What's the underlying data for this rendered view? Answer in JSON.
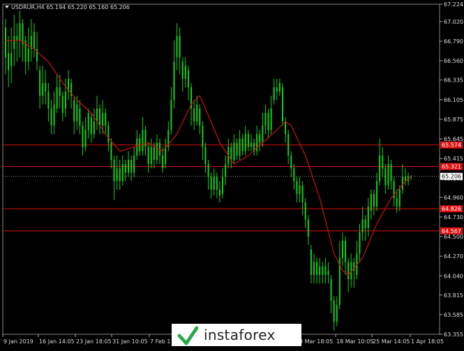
{
  "chart_data": {
    "type": "candlestick",
    "symbol_line": {
      "symbol": "USDRUR,H4",
      "open": "65.194",
      "high": "65.220",
      "low": "65.160",
      "close": "65.206"
    },
    "ylim": [
      63.355,
      67.224
    ],
    "y_ticks": [
      "67.224",
      "67.020",
      "66.790",
      "66.560",
      "66.335",
      "66.105",
      "65.875",
      "65.645",
      "65.415",
      "65.185",
      "64.960",
      "64.730",
      "64.500",
      "64.270",
      "64.040",
      "63.815",
      "63.585",
      "63.355"
    ],
    "x_labels": [
      "9 Jan 2019",
      "16 Jan 14:05",
      "23 Jan 18:05",
      "31 Jan 10:05",
      "7 Feb 1",
      "8 Mar 18:05",
      "18 Mar 10:05",
      "25 Mar 14:05",
      "1 Apr 18:05"
    ],
    "current_price": "65.206",
    "levels": [
      {
        "label": "65.574",
        "value": 65.574
      },
      {
        "label": "65.321",
        "value": 65.321
      },
      {
        "label": "64.826",
        "value": 64.826
      },
      {
        "label": "64.567",
        "value": 64.567
      }
    ],
    "x_count": 152,
    "candles": [
      [
        0,
        66.95,
        66.6,
        67.05,
        66.4
      ],
      [
        1,
        66.65,
        66.45,
        66.85,
        66.25
      ],
      [
        2,
        66.5,
        66.65,
        66.95,
        66.3
      ],
      [
        3,
        66.7,
        66.85,
        67.1,
        66.5
      ],
      [
        4,
        66.85,
        66.8,
        67.0,
        66.55
      ],
      [
        5,
        66.8,
        67.0,
        67.15,
        66.6
      ],
      [
        6,
        67.0,
        66.75,
        67.05,
        66.55
      ],
      [
        7,
        66.8,
        66.55,
        66.85,
        66.4
      ],
      [
        8,
        66.55,
        66.7,
        66.95,
        66.45
      ],
      [
        9,
        66.7,
        66.85,
        67.05,
        66.55
      ],
      [
        10,
        66.9,
        66.7,
        67.0,
        66.6
      ],
      [
        11,
        66.7,
        66.55,
        66.9,
        66.45
      ],
      [
        12,
        66.45,
        66.15,
        66.5,
        66.0
      ],
      [
        13,
        66.15,
        66.3,
        66.5,
        66.05
      ],
      [
        14,
        66.3,
        66.2,
        66.45,
        66.05
      ],
      [
        15,
        66.2,
        66.0,
        66.3,
        65.85
      ],
      [
        16,
        66.0,
        65.8,
        66.1,
        65.7
      ],
      [
        17,
        65.8,
        66.05,
        66.2,
        65.7
      ],
      [
        18,
        66.0,
        66.25,
        66.4,
        65.95
      ],
      [
        19,
        66.25,
        66.15,
        66.4,
        66.0
      ],
      [
        20,
        66.15,
        65.95,
        66.2,
        65.85
      ],
      [
        21,
        66.0,
        66.2,
        66.35,
        65.9
      ],
      [
        22,
        66.2,
        66.35,
        66.45,
        66.1
      ],
      [
        23,
        66.3,
        66.15,
        66.35,
        66.0
      ],
      [
        24,
        66.1,
        65.85,
        66.15,
        65.7
      ],
      [
        25,
        65.85,
        66.05,
        66.15,
        65.75
      ],
      [
        26,
        66.0,
        65.8,
        66.1,
        65.7
      ],
      [
        27,
        65.8,
        65.55,
        65.85,
        65.45
      ],
      [
        28,
        65.55,
        65.75,
        65.9,
        65.5
      ],
      [
        29,
        65.75,
        65.95,
        66.0,
        65.65
      ],
      [
        30,
        65.9,
        65.7,
        65.95,
        65.6
      ],
      [
        31,
        65.7,
        65.85,
        66.0,
        65.65
      ],
      [
        32,
        65.85,
        66.0,
        66.15,
        65.75
      ],
      [
        33,
        66.0,
        65.8,
        66.05,
        65.7
      ],
      [
        34,
        65.8,
        65.95,
        66.1,
        65.7
      ],
      [
        35,
        65.95,
        65.8,
        66.0,
        65.7
      ],
      [
        36,
        65.8,
        65.6,
        65.85,
        65.5
      ],
      [
        37,
        65.6,
        65.4,
        65.65,
        65.3
      ],
      [
        38,
        65.4,
        65.15,
        65.45,
        64.93
      ],
      [
        39,
        65.15,
        65.3,
        65.45,
        65.05
      ],
      [
        40,
        65.3,
        65.15,
        65.4,
        65.05
      ],
      [
        41,
        65.15,
        65.35,
        65.45,
        65.1
      ],
      [
        42,
        65.35,
        65.25,
        65.4,
        65.15
      ],
      [
        43,
        65.25,
        65.4,
        65.5,
        65.2
      ],
      [
        44,
        65.4,
        65.25,
        65.45,
        65.15
      ],
      [
        45,
        65.25,
        65.45,
        65.55,
        65.2
      ],
      [
        46,
        65.45,
        65.65,
        65.75,
        65.4
      ],
      [
        47,
        65.65,
        65.5,
        65.7,
        65.45
      ],
      [
        48,
        65.5,
        65.75,
        65.9,
        65.45
      ],
      [
        49,
        65.75,
        65.55,
        65.8,
        65.45
      ],
      [
        50,
        65.55,
        65.35,
        65.6,
        65.25
      ],
      [
        51,
        65.35,
        65.55,
        65.65,
        65.3
      ],
      [
        52,
        65.55,
        65.4,
        65.6,
        65.3
      ],
      [
        53,
        65.4,
        65.6,
        65.7,
        65.35
      ],
      [
        54,
        65.6,
        65.45,
        65.65,
        65.35
      ],
      [
        55,
        65.45,
        65.3,
        65.55,
        65.25
      ],
      [
        56,
        65.35,
        65.55,
        65.65,
        65.3
      ],
      [
        57,
        65.55,
        65.75,
        65.85,
        65.5
      ],
      [
        58,
        65.75,
        66.1,
        66.25,
        65.7
      ],
      [
        59,
        66.1,
        66.55,
        66.8,
        66.0
      ],
      [
        60,
        66.6,
        66.85,
        67.0,
        66.45
      ],
      [
        61,
        66.85,
        66.6,
        66.95,
        66.4
      ],
      [
        62,
        66.55,
        66.35,
        66.6,
        66.2
      ],
      [
        63,
        66.35,
        66.5,
        66.6,
        66.25
      ],
      [
        64,
        66.45,
        66.25,
        66.5,
        66.1
      ],
      [
        65,
        66.25,
        66.0,
        66.3,
        65.8
      ],
      [
        66,
        66.0,
        65.85,
        66.1,
        65.75
      ],
      [
        67,
        65.85,
        66.05,
        66.15,
        65.8
      ],
      [
        68,
        66.0,
        65.8,
        66.05,
        65.7
      ],
      [
        69,
        65.8,
        65.55,
        65.85,
        65.4
      ],
      [
        70,
        65.55,
        65.35,
        65.6,
        65.25
      ],
      [
        71,
        65.35,
        65.2,
        65.4,
        65.05
      ],
      [
        72,
        65.2,
        65.05,
        65.25,
        64.95
      ],
      [
        73,
        65.05,
        65.2,
        65.3,
        64.98
      ],
      [
        74,
        65.2,
        65.05,
        65.25,
        64.95
      ],
      [
        75,
        65.05,
        64.98,
        65.15,
        64.9
      ],
      [
        76,
        65.0,
        65.2,
        65.3,
        64.95
      ],
      [
        77,
        65.2,
        65.35,
        65.45,
        65.1
      ],
      [
        78,
        65.35,
        65.55,
        65.65,
        65.3
      ],
      [
        79,
        65.55,
        65.4,
        65.6,
        65.3
      ],
      [
        80,
        65.4,
        65.6,
        65.7,
        65.35
      ],
      [
        81,
        65.6,
        65.45,
        65.65,
        65.4
      ],
      [
        82,
        65.45,
        65.65,
        65.75,
        65.4
      ],
      [
        83,
        65.65,
        65.5,
        65.7,
        65.45
      ],
      [
        84,
        65.5,
        65.7,
        65.8,
        65.45
      ],
      [
        85,
        65.7,
        65.55,
        65.75,
        65.5
      ],
      [
        86,
        65.55,
        65.6,
        65.7,
        65.5
      ],
      [
        87,
        65.6,
        65.5,
        65.65,
        65.45
      ],
      [
        88,
        65.5,
        65.7,
        65.8,
        65.45
      ],
      [
        89,
        65.7,
        65.6,
        65.75,
        65.5
      ],
      [
        90,
        65.6,
        65.8,
        65.95,
        65.55
      ],
      [
        91,
        65.8,
        65.95,
        66.05,
        65.7
      ],
      [
        92,
        65.95,
        65.75,
        66.0,
        65.65
      ],
      [
        93,
        65.75,
        66.0,
        66.15,
        65.7
      ],
      [
        94,
        66.1,
        66.25,
        66.35,
        66.05
      ],
      [
        95,
        66.25,
        66.2,
        66.35,
        66.1
      ],
      [
        96,
        66.2,
        66.3,
        66.35,
        66.15
      ],
      [
        97,
        66.25,
        65.85,
        66.3,
        65.8
      ],
      [
        98,
        65.85,
        65.7,
        65.9,
        65.6
      ],
      [
        99,
        65.7,
        65.45,
        65.75,
        65.35
      ],
      [
        100,
        65.45,
        65.3,
        65.5,
        65.2
      ],
      [
        101,
        65.3,
        65.15,
        65.35,
        65.05
      ],
      [
        102,
        65.15,
        65.0,
        65.2,
        64.9
      ],
      [
        103,
        65.0,
        65.1,
        65.2,
        64.9
      ],
      [
        104,
        65.1,
        64.9,
        65.15,
        64.75
      ],
      [
        105,
        64.9,
        64.7,
        64.95,
        64.6
      ],
      [
        106,
        64.7,
        64.5,
        64.75,
        64.4
      ],
      [
        107,
        64.35,
        64.05,
        64.4,
        63.95
      ],
      [
        108,
        64.05,
        64.2,
        64.3,
        63.95
      ],
      [
        109,
        64.2,
        64.05,
        64.25,
        63.95
      ],
      [
        110,
        64.05,
        64.15,
        64.25,
        63.95
      ],
      [
        111,
        64.15,
        64.05,
        64.2,
        63.95
      ],
      [
        112,
        64.05,
        64.15,
        64.25,
        63.95
      ],
      [
        113,
        64.1,
        64.05,
        64.2,
        63.95
      ],
      [
        114,
        64.0,
        63.75,
        64.05,
        63.6
      ],
      [
        115,
        63.75,
        63.5,
        63.8,
        63.4
      ],
      [
        116,
        63.5,
        63.7,
        63.8,
        63.45
      ],
      [
        117,
        63.7,
        64.25,
        64.45,
        63.65
      ],
      [
        118,
        64.25,
        64.45,
        64.55,
        64.15
      ],
      [
        119,
        64.45,
        64.2,
        64.5,
        64.05
      ],
      [
        120,
        64.2,
        64.0,
        64.25,
        63.85
      ],
      [
        121,
        64.0,
        64.2,
        64.3,
        63.9
      ],
      [
        122,
        64.2,
        64.1,
        64.25,
        63.9
      ],
      [
        123,
        64.05,
        64.3,
        64.45,
        64.0
      ],
      [
        124,
        64.3,
        64.55,
        64.65,
        64.2
      ],
      [
        125,
        64.55,
        64.7,
        64.85,
        64.45
      ],
      [
        126,
        64.7,
        64.6,
        64.75,
        64.45
      ],
      [
        127,
        64.6,
        64.85,
        64.95,
        64.5
      ],
      [
        128,
        64.8,
        65.0,
        65.05,
        64.7
      ],
      [
        129,
        65.0,
        64.85,
        65.05,
        64.75
      ],
      [
        130,
        64.85,
        65.15,
        65.25,
        64.8
      ],
      [
        131,
        65.15,
        65.45,
        65.65,
        65.1
      ],
      [
        132,
        65.45,
        65.3,
        65.55,
        65.2
      ],
      [
        133,
        65.3,
        65.1,
        65.35,
        65.0
      ],
      [
        134,
        65.1,
        65.35,
        65.45,
        65.05
      ],
      [
        135,
        65.35,
        65.15,
        65.4,
        65.05
      ],
      [
        136,
        65.15,
        64.95,
        65.2,
        64.85
      ],
      [
        137,
        64.95,
        64.85,
        65.05,
        64.78
      ],
      [
        138,
        64.85,
        65.05,
        65.1,
        64.8
      ],
      [
        139,
        65.05,
        65.2,
        65.35,
        65.0
      ],
      [
        140,
        65.2,
        65.15,
        65.3,
        65.1
      ],
      [
        141,
        65.15,
        65.2,
        65.25,
        65.1
      ],
      [
        142,
        65.194,
        65.206,
        65.22,
        65.16
      ]
    ],
    "ma": [
      [
        0,
        66.8
      ],
      [
        5,
        66.8
      ],
      [
        10,
        66.7
      ],
      [
        15,
        66.55
      ],
      [
        20,
        66.3
      ],
      [
        25,
        66.1
      ],
      [
        30,
        65.95
      ],
      [
        35,
        65.7
      ],
      [
        40,
        65.5
      ],
      [
        45,
        65.55
      ],
      [
        50,
        65.6
      ],
      [
        55,
        65.5
      ],
      [
        60,
        65.7
      ],
      [
        65,
        66.05
      ],
      [
        68,
        66.15
      ],
      [
        70,
        66.0
      ],
      [
        75,
        65.6
      ],
      [
        80,
        65.35
      ],
      [
        85,
        65.45
      ],
      [
        90,
        65.6
      ],
      [
        95,
        65.75
      ],
      [
        98,
        65.85
      ],
      [
        100,
        65.8
      ],
      [
        105,
        65.45
      ],
      [
        110,
        64.95
      ],
      [
        115,
        64.3
      ],
      [
        118,
        64.1
      ],
      [
        120,
        64.05
      ],
      [
        125,
        64.25
      ],
      [
        130,
        64.65
      ],
      [
        135,
        64.95
      ],
      [
        140,
        65.15
      ],
      [
        142,
        65.2
      ]
    ]
  }
}
